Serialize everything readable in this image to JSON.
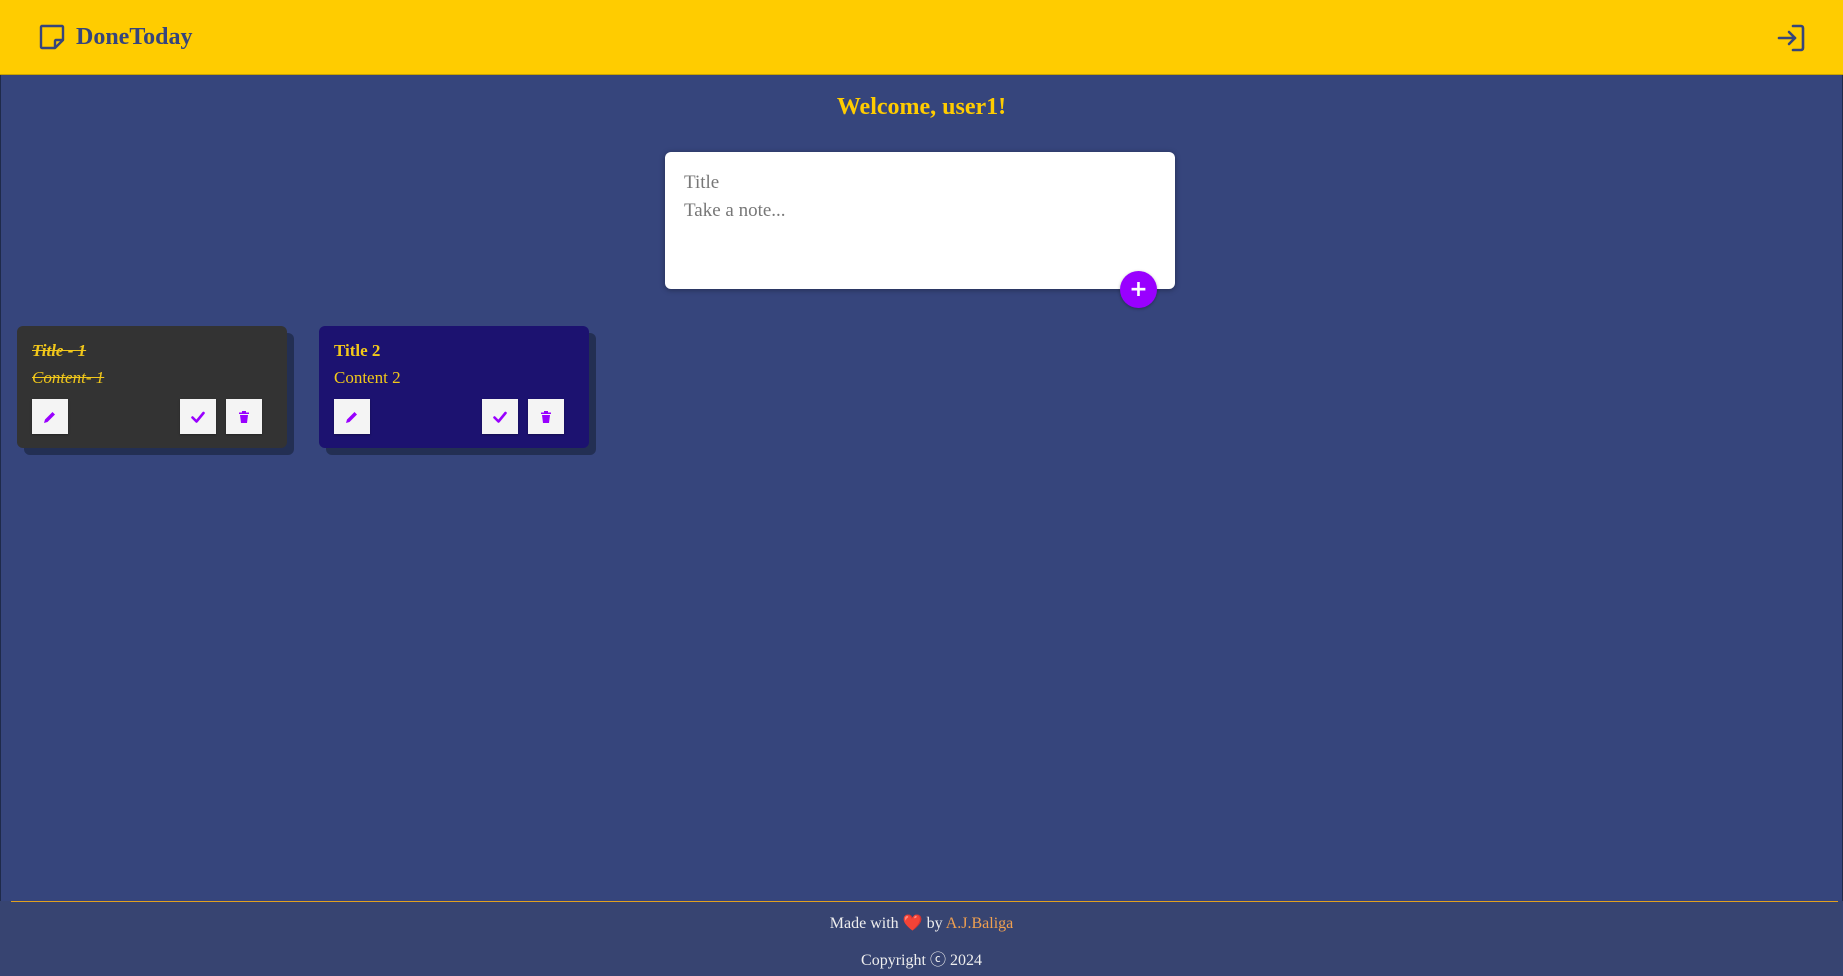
{
  "app": {
    "title": "DoneToday"
  },
  "header": {
    "brand_icon": "sticky-note-icon",
    "login_icon": "sign-in-icon"
  },
  "welcome": "Welcome, user1!",
  "form": {
    "title_placeholder": "Title",
    "content_placeholder": "Take a note...",
    "add_label": "+"
  },
  "notes": [
    {
      "title": "Title - 1",
      "content": "Content- 1",
      "done": true
    },
    {
      "title": "Title 2",
      "content": "Content 2",
      "done": false
    }
  ],
  "footer": {
    "made_prefix": "Made with",
    "heart": "❤️",
    "by": "by",
    "author": "A.J.Baliga",
    "copyright": "Copyright ⓒ 2024"
  },
  "colors": {
    "header_bg": "#ffcc00",
    "page_bg": "#36457c",
    "accent": "#9900ff",
    "note_done_bg": "#333333",
    "note_bg": "#1c1270",
    "note_text": "#f2c81a"
  }
}
